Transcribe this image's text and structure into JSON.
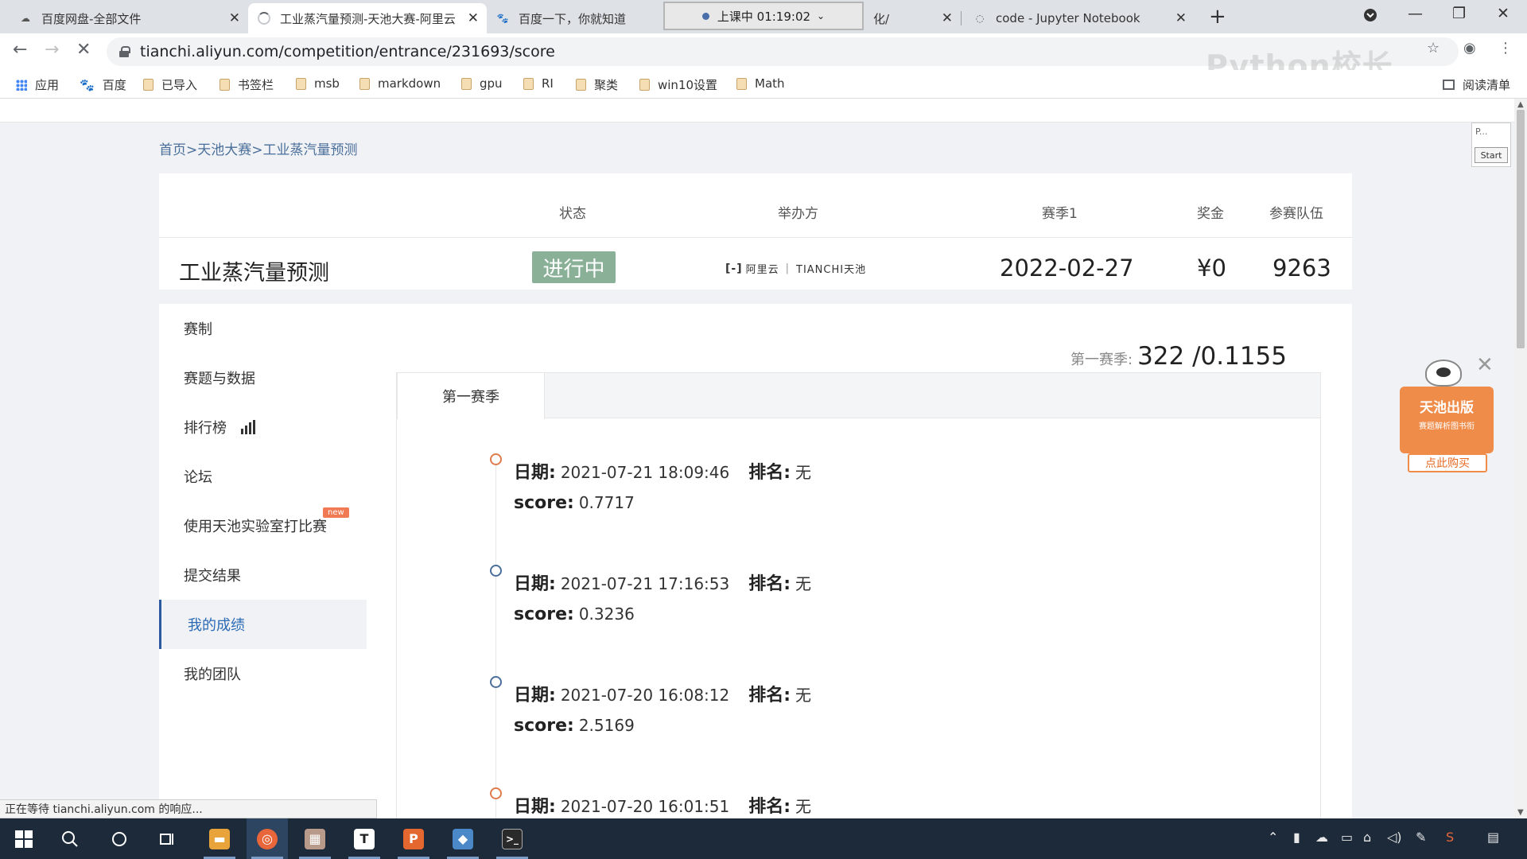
{
  "browser": {
    "tabs": [
      {
        "title": "百度网盘-全部文件",
        "icon": "baidu-pan-icon"
      },
      {
        "title": "工业蒸汽量预测-天池大赛-阿里云",
        "icon": "loading-spinner-icon",
        "active": true
      },
      {
        "title": "百度一下，你就知道",
        "icon": "baidu-paw-icon"
      },
      {
        "title": "化/",
        "icon": ""
      },
      {
        "title": "code - Jupyter Notebook",
        "icon": "jupyter-icon"
      }
    ],
    "recording_label": "上课中 01:19:02",
    "url": "tianchi.aliyun.com/competition/entrance/231693/score",
    "watermark": "Python校长",
    "bookmarks": [
      "应用",
      "百度",
      "已导入",
      "书签栏",
      "msb",
      "markdown",
      "gpu",
      "RI",
      "聚类",
      "win10设置",
      "Math"
    ],
    "reading_list": "阅读清单",
    "status_text": "正在等待 tianchi.aliyun.com 的响应..."
  },
  "page": {
    "breadcrumb": "首页>天池大赛>工业蒸汽量预测",
    "competition": {
      "headers": {
        "status": "状态",
        "organizer": "举办方",
        "season": "赛季1",
        "prize": "奖金",
        "teams": "参赛队伍"
      },
      "title": "工业蒸汽量预测",
      "status": "进行中",
      "organizer_logo_text": {
        "left": "阿里云",
        "right": "TIANCHI天池"
      },
      "season_date": "2022-02-27",
      "prize": "¥0",
      "teams": "9263"
    },
    "sidebar": {
      "items": [
        {
          "label": "赛制"
        },
        {
          "label": "赛题与数据"
        },
        {
          "label": "排行榜",
          "icon": "bar-chart-icon"
        },
        {
          "label": "论坛"
        },
        {
          "label": "使用天池实验室打比赛",
          "badge": "new"
        },
        {
          "label": "提交结果"
        },
        {
          "label": "我的成绩",
          "active": true
        },
        {
          "label": "我的团队"
        }
      ]
    },
    "scores": {
      "season_label": "第一赛季:",
      "season_value": "322 /0.1155",
      "tab": "第一赛季",
      "date_key": "日期:",
      "rank_key": "排名:",
      "score_key": "score:",
      "entries": [
        {
          "date": "2021-07-21 18:09:46",
          "rank": "无",
          "score": "0.7717",
          "dot_color": "#e07b4c"
        },
        {
          "date": "2021-07-21 17:16:53",
          "rank": "无",
          "score": "0.3236",
          "dot_color": "#4a6f9a"
        },
        {
          "date": "2021-07-20 16:08:12",
          "rank": "无",
          "score": "2.5169",
          "dot_color": "#4a6f9a"
        },
        {
          "date": "2021-07-20 16:01:51",
          "rank": "无",
          "score": "",
          "dot_color": "#e07b4c"
        }
      ]
    },
    "ad": {
      "title": "天池出版",
      "subtitle": "赛题解析图书衔",
      "button": "点此购买"
    },
    "ext_popup": {
      "text": "P...",
      "button": "Start"
    }
  }
}
